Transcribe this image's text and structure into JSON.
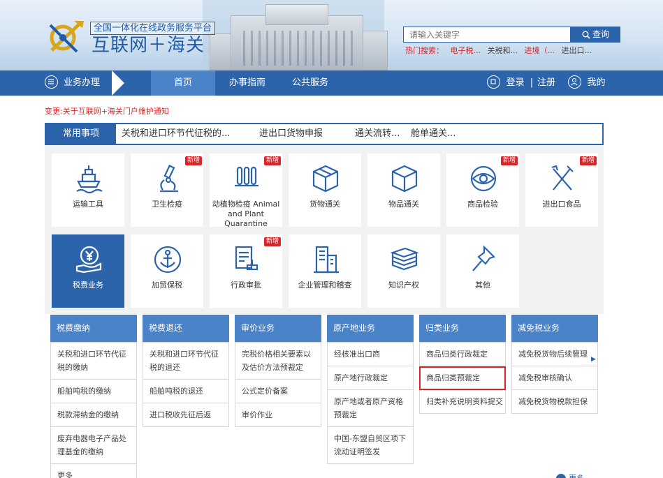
{
  "header": {
    "slogan": "全国一体化在线政务服务平台",
    "title": "互联网＋海关",
    "search_placeholder": "请输入关键字",
    "search_button": "查询",
    "hot_label": "热门搜索：",
    "hot_items": [
      "电子税...",
      "关税和...",
      "进境（...",
      "进出口..."
    ]
  },
  "nav": {
    "menu_label": "业务办理",
    "items": [
      "首页",
      "办事指南",
      "公共服务"
    ],
    "login": "登录",
    "separator": "|",
    "register": "注册",
    "mine": "我的"
  },
  "notice": "变更:关于互联网+海关门户维护通知",
  "tabs": {
    "active": "常用事项",
    "items": [
      "关税和进口环节代征税的...",
      "进出口货物申报",
      "通关流转...",
      "舱单通关..."
    ]
  },
  "tiles": [
    {
      "label": "运输工具",
      "icon": "ship-icon",
      "badge": ""
    },
    {
      "label": "卫生检疫",
      "icon": "microscope-icon",
      "badge": "新增"
    },
    {
      "label": "动植物检疫 Animal and Plant Quarantine",
      "icon": "test-tubes-icon",
      "badge": "新增"
    },
    {
      "label": "货物通关",
      "icon": "package-icon",
      "badge": ""
    },
    {
      "label": "物品通关",
      "icon": "cube-icon",
      "badge": ""
    },
    {
      "label": "商品检验",
      "icon": "eye-icon",
      "badge": "新增"
    },
    {
      "label": "进出口食品",
      "icon": "fork-knife-icon",
      "badge": "新增"
    },
    {
      "label": "税费业务",
      "icon": "yen-hand-icon",
      "badge": ""
    },
    {
      "label": "加贸保税",
      "icon": "anchor-icon",
      "badge": ""
    },
    {
      "label": "行政审批",
      "icon": "document-stamp-icon",
      "badge": "新增"
    },
    {
      "label": "企业管理和稽查",
      "icon": "building-icon",
      "badge": ""
    },
    {
      "label": "知识产权",
      "icon": "books-icon",
      "badge": ""
    },
    {
      "label": "其他",
      "icon": "pin-icon",
      "badge": ""
    }
  ],
  "columns": [
    {
      "title": "税费缴纳",
      "items": [
        "关税和进口环节代征税的缴纳",
        "船舶吨税的缴纳",
        "税款滞纳金的缴纳",
        "废弃电器电子产品处理基金的缴纳",
        "更多"
      ]
    },
    {
      "title": "税费退还",
      "items": [
        "关税和进口环节代征税的退还",
        "船舶吨税的退还",
        "进口税收先征后返"
      ]
    },
    {
      "title": "审价业务",
      "items": [
        "完税价格相关要素以及估价方法预裁定",
        "公式定价备案",
        "审价作业"
      ]
    },
    {
      "title": "原产地业务",
      "items": [
        "经核准出口商",
        "原产地行政裁定",
        "原产地或者原产资格预裁定",
        "中国-东盟自贸区项下流动证明签发"
      ]
    },
    {
      "title": "归类业务",
      "items": [
        "商品归类行政裁定",
        "商品归类预裁定",
        "归类补充说明资料提交"
      ]
    },
    {
      "title": "减免税业务",
      "items": [
        "减免税货物后续管理",
        "减免税审核确认",
        "减免税货物税款担保"
      ]
    }
  ],
  "more": "更多"
}
